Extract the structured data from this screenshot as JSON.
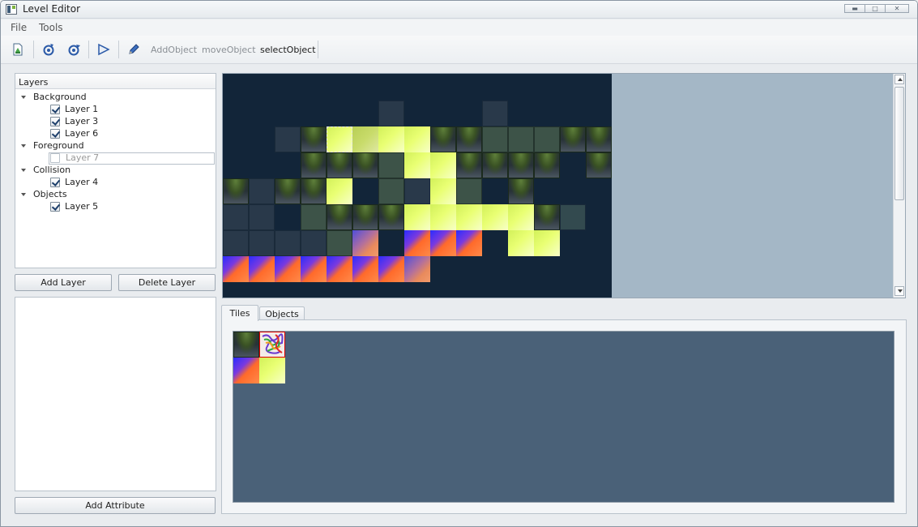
{
  "window": {
    "title": "Level Editor",
    "controls": [
      "minimize",
      "maximize",
      "close"
    ]
  },
  "menu": {
    "items": [
      "File",
      "Tools"
    ]
  },
  "toolbar": {
    "icons": [
      "new-file-icon",
      "rotate-left-icon",
      "rotate-right-icon",
      "play-icon",
      "pencil-icon"
    ],
    "modes": [
      {
        "label": "AddObject",
        "active": false
      },
      {
        "label": "moveObject",
        "active": false
      },
      {
        "label": "selectObject",
        "active": true
      }
    ]
  },
  "layers": {
    "header": "Layers",
    "groups": [
      {
        "name": "Background",
        "layers": [
          {
            "label": "Layer 1",
            "checked": true
          },
          {
            "label": "Layer 3",
            "checked": true
          },
          {
            "label": "Layer 6",
            "checked": true
          }
        ]
      },
      {
        "name": "Foreground",
        "layers": [
          {
            "label": "Layer 7",
            "checked": false,
            "selected": true
          }
        ]
      },
      {
        "name": "Collision",
        "layers": [
          {
            "label": "Layer 4",
            "checked": true
          }
        ]
      },
      {
        "name": "Objects",
        "layers": [
          {
            "label": "Layer 5",
            "checked": true
          }
        ]
      }
    ]
  },
  "buttons": {
    "add_layer": "Add Layer",
    "delete_layer": "Delete Layer",
    "add_attribute": "Add Attribute"
  },
  "tabs": {
    "tiles": "Tiles",
    "objects": "Objects",
    "active": "Tiles"
  },
  "colors": {
    "map_bg": "#122539",
    "canvas_bg": "#a4b7c6",
    "palette_bg": "#4a6178"
  }
}
